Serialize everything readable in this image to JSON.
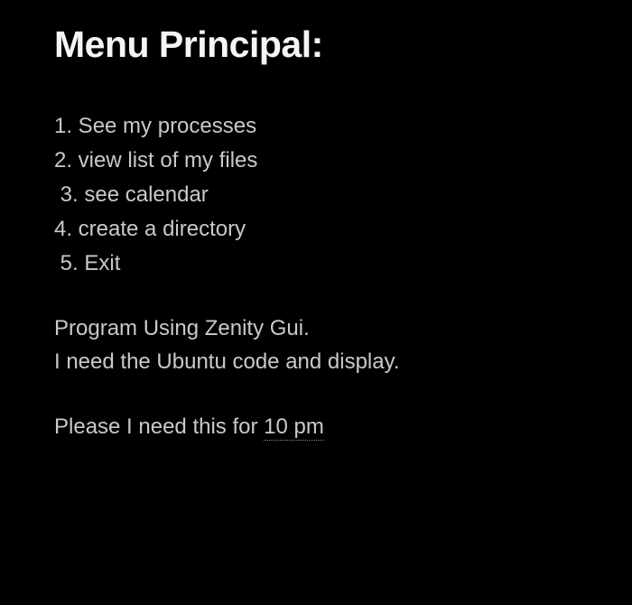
{
  "title": "Menu Principal:",
  "menu": {
    "item1": "1. See my processes",
    "item2": "2. view list of my files",
    "item3": " 3. see calendar",
    "item4": "4. create a directory",
    "item5": " 5. Exit"
  },
  "description": {
    "line1": "Program Using Zenity Gui.",
    "line2": "I need the Ubuntu code and display."
  },
  "deadline": {
    "prefix": "Please I need this for ",
    "time": "10 pm"
  }
}
